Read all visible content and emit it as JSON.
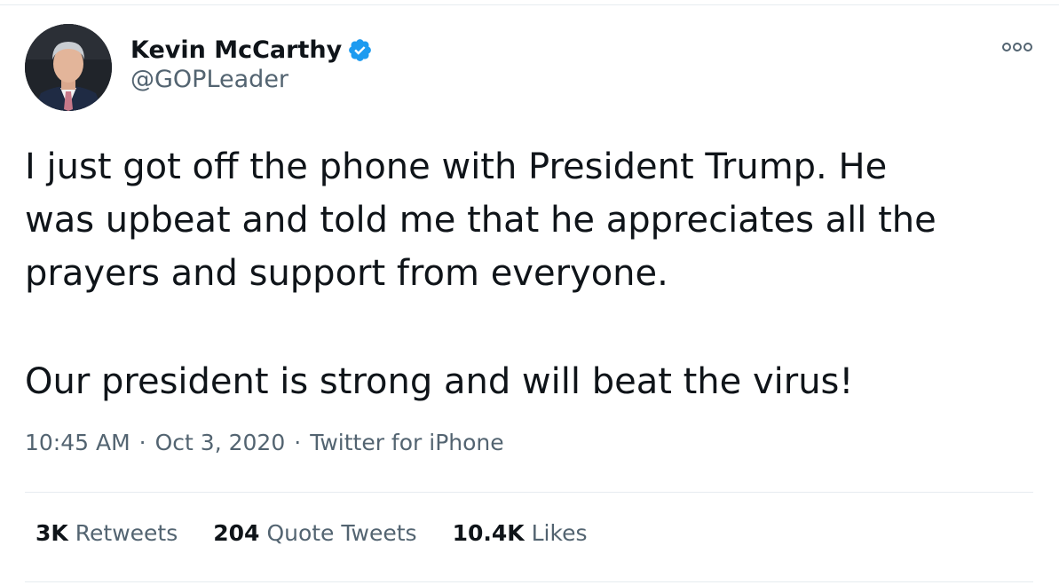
{
  "author": {
    "display_name": "Kevin McCarthy",
    "handle": "@GOPLeader",
    "verified": true
  },
  "tweet": {
    "lines": [
      "I just got off the phone with President Trump. He",
      "was upbeat and told me that he appreciates all the",
      "prayers and support from everyone."
    ],
    "second_paragraph": "Our president is strong and will beat the virus!",
    "time": "10:45 AM",
    "date": "Oct 3, 2020",
    "source": "Twitter for iPhone",
    "separator": "·"
  },
  "stats": {
    "retweets_count": "3K",
    "retweets_label": "Retweets",
    "quotes_count": "204",
    "quotes_label": "Quote Tweets",
    "likes_count": "10.4K",
    "likes_label": "Likes"
  },
  "icons": {
    "verified": "verified-badge-icon",
    "more": "more-options-icon"
  },
  "colors": {
    "text_primary": "#0f1419",
    "text_secondary": "#536471",
    "verified_blue": "#1d9bf0",
    "divider": "#e6ecf0"
  }
}
